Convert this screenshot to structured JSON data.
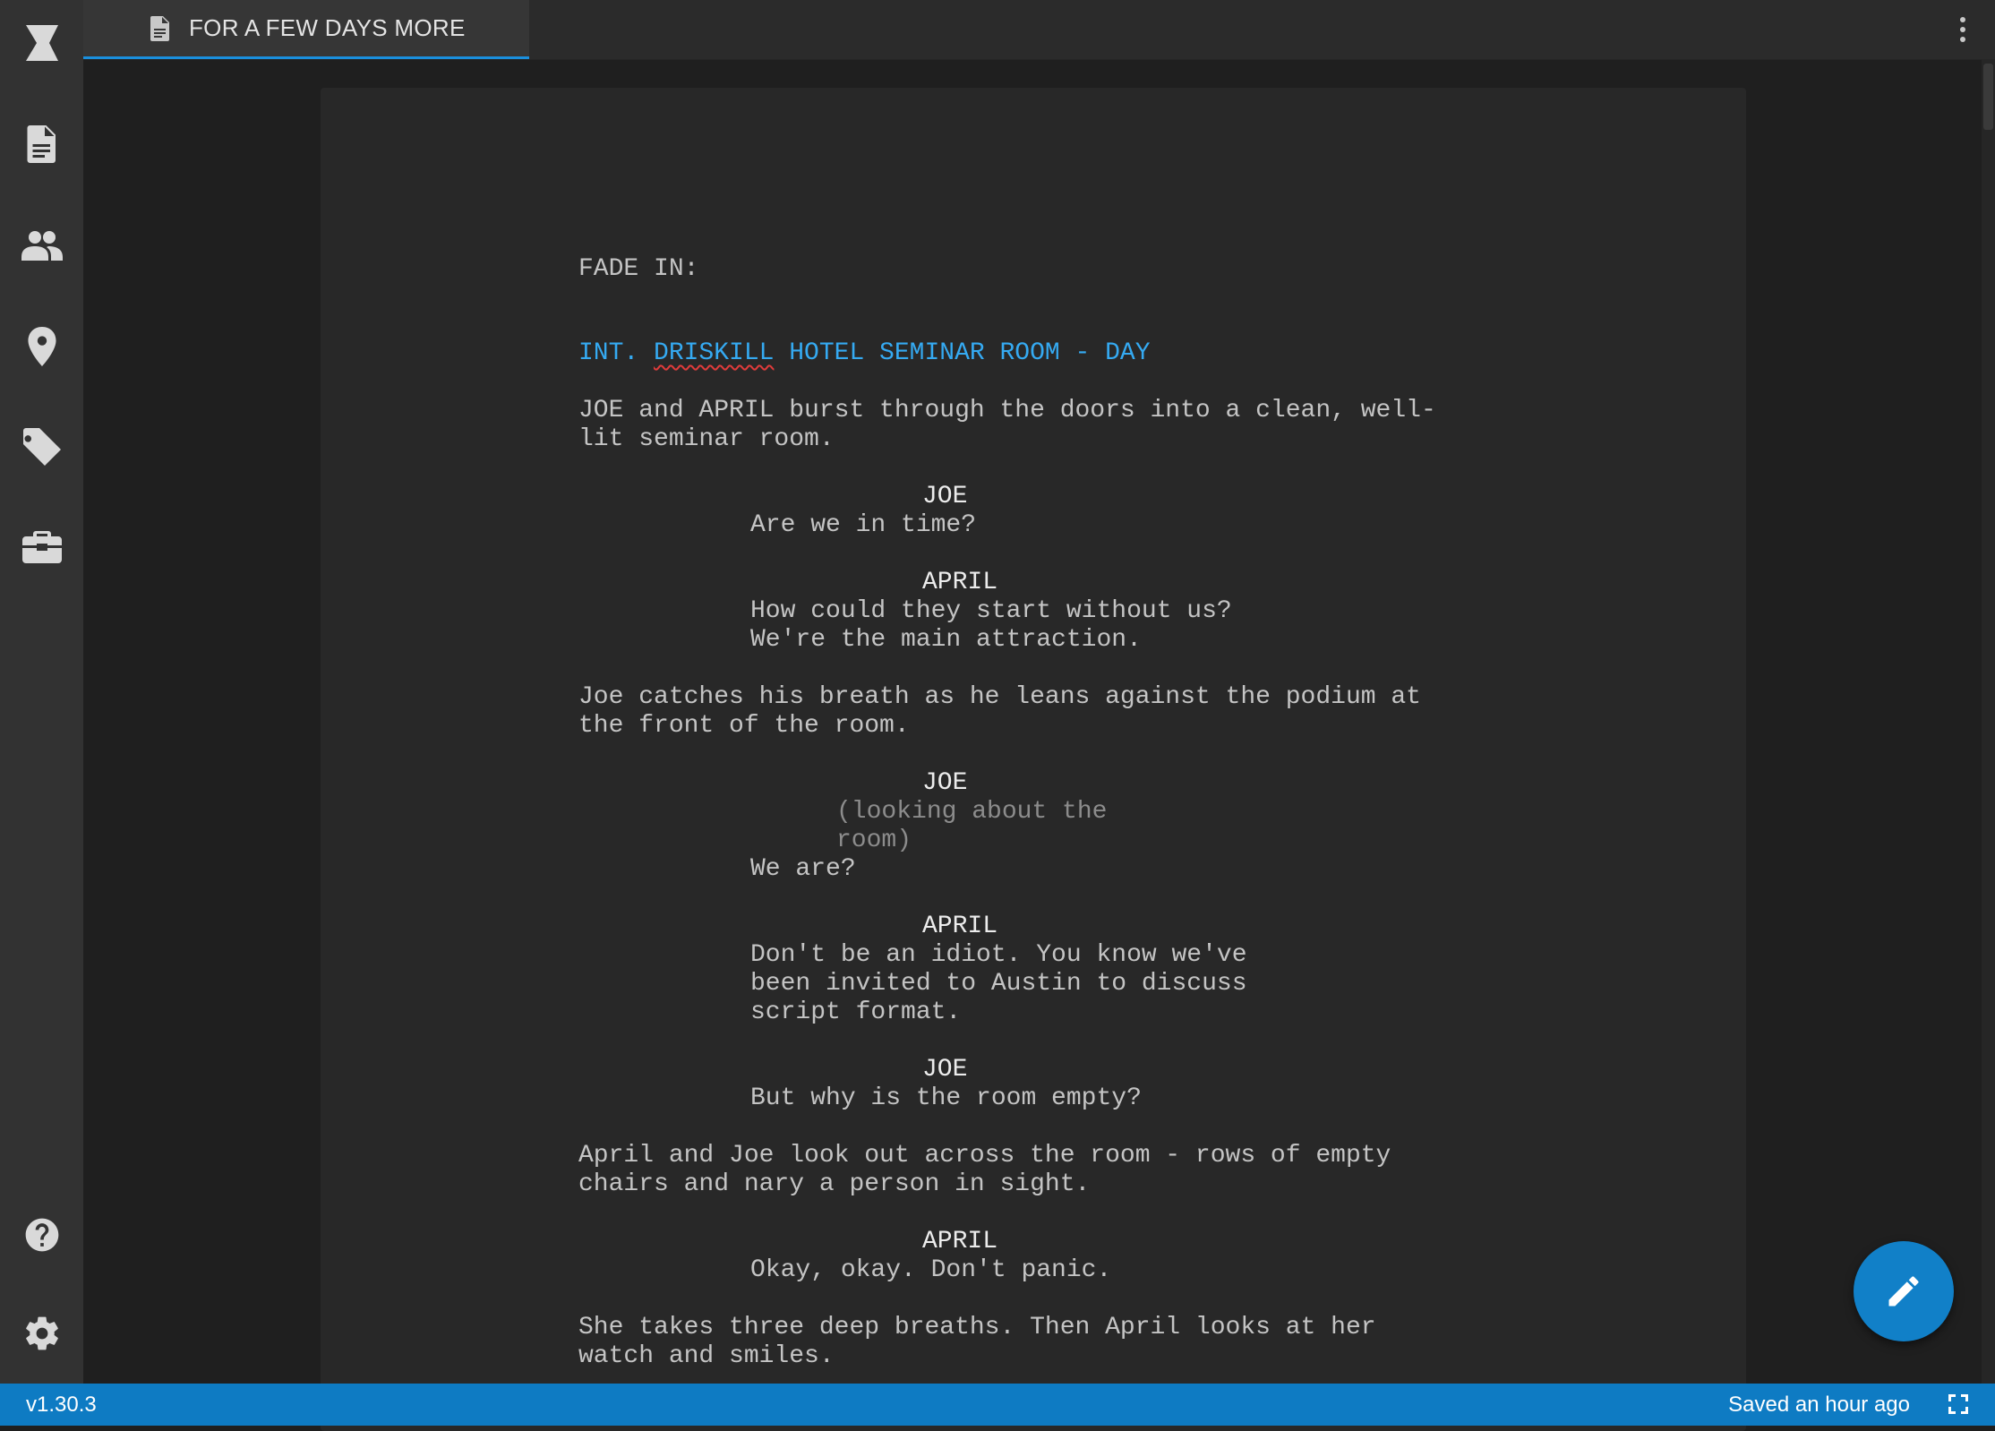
{
  "tab": {
    "title": "FOR A FEW DAYS MORE"
  },
  "rail": {
    "items": [
      "logo-icon",
      "script-icon",
      "characters-icon",
      "locations-icon",
      "tags-icon",
      "tools-icon"
    ],
    "bottom": [
      "help-icon",
      "settings-icon"
    ]
  },
  "script": {
    "transition": "FADE IN:",
    "scene_heading_prefix": "INT. ",
    "scene_heading_misspelled": "DRISKILL",
    "scene_heading_rest": " HOTEL SEMINAR ROOM - DAY",
    "action1_line1": "JOE and APRIL burst through the doors into a clean, well-",
    "action1_line2": "lit seminar room.",
    "char1": "JOE",
    "dial1_line1": "Are we in time?",
    "char2": "APRIL",
    "dial2_line1": "How could they start without us?",
    "dial2_line2": "We're the main attraction.",
    "action2_line1": "Joe catches his breath as he leans against the podium at",
    "action2_line2": "the front of the room.",
    "char3": "JOE",
    "paren3_line1": "(looking about the",
    "paren3_line2": "room)",
    "dial3_line1": "We are?",
    "char4": "APRIL",
    "dial4_line1": "Don't be an idiot. You know we've",
    "dial4_line2": "been invited to Austin to discuss",
    "dial4_line3": "script format.",
    "char5": "JOE",
    "dial5_line1": "But why is the room empty?",
    "action3_line1": "April and Joe look out across the room - rows of empty",
    "action3_line2": "chairs and nary a person in sight.",
    "char6": "APRIL",
    "dial6_line1": "Okay, okay. Don't panic.",
    "action4_line1": "She takes three deep breaths. Then April looks at her",
    "action4_line2": "watch and smiles."
  },
  "status": {
    "version": "v1.30.3",
    "saved": "Saved an hour ago"
  },
  "colors": {
    "accent": "#0e7bc3",
    "scene_heading": "#35aaf2",
    "tab_underline": "#1a8fdd"
  }
}
